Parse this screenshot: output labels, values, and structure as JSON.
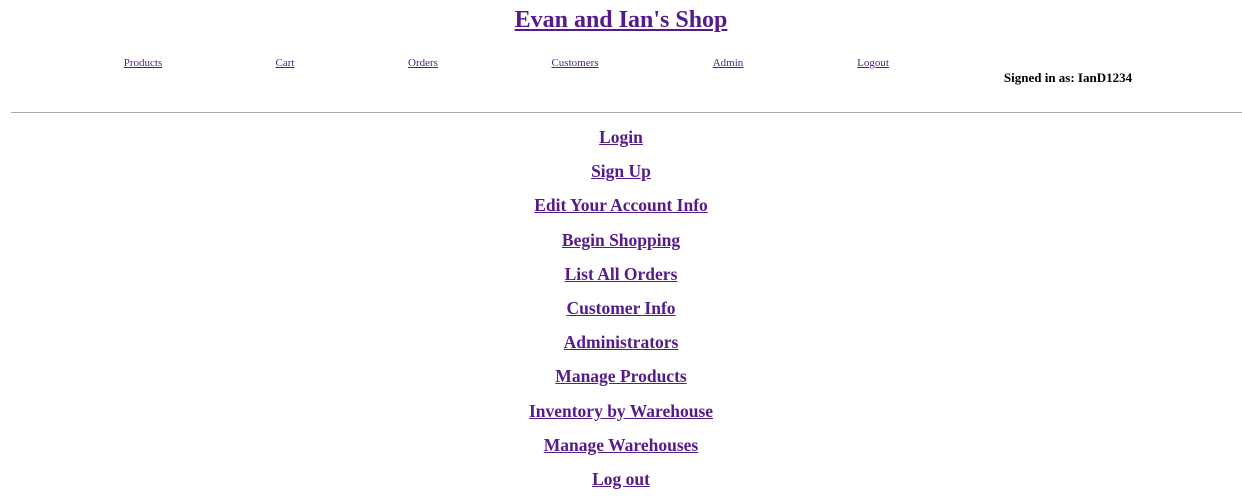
{
  "header": {
    "title": "Evan and Ian's Shop"
  },
  "nav": {
    "products": "Products",
    "cart": "Cart",
    "orders": "Orders",
    "customers": "Customers",
    "admin": "Admin",
    "logout": "Logout"
  },
  "user": {
    "signed_in": "Signed in as: IanD1234"
  },
  "menu": {
    "items": [
      "Login",
      "Sign Up",
      "Edit Your Account Info",
      "Begin Shopping",
      "List All Orders",
      "Customer Info",
      "Administrators",
      "Manage Products",
      "Inventory by Warehouse",
      "Manage Warehouses",
      "Log out"
    ]
  },
  "colors": {
    "link": "#551a8b",
    "divider": "#a9a9a9"
  }
}
